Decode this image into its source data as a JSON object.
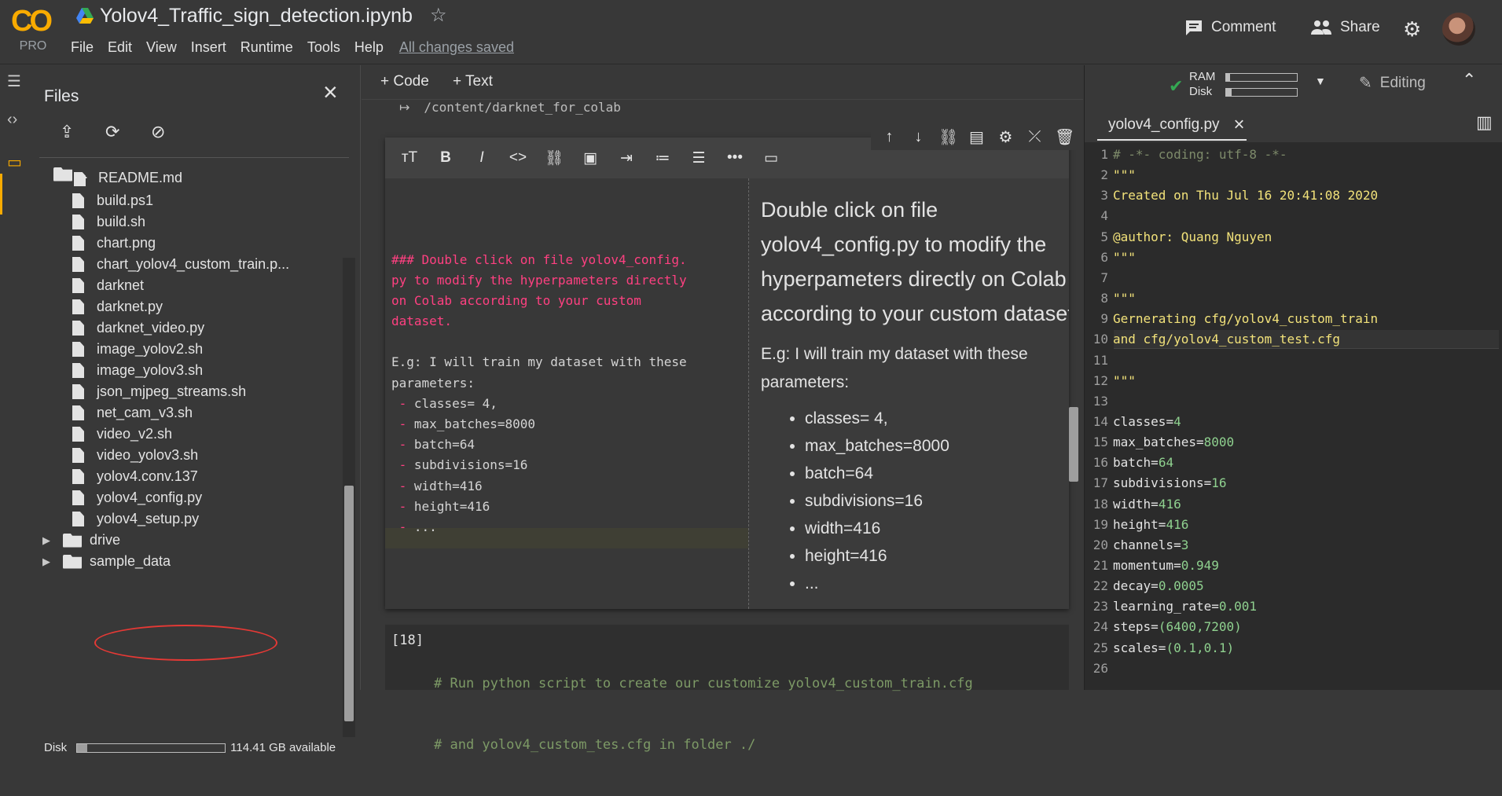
{
  "header": {
    "logo_text": "CO",
    "logo_badge": "PRO",
    "notebook_title": "Yolov4_Traffic_sign_detection.ipynb",
    "menu": [
      "File",
      "Edit",
      "View",
      "Insert",
      "Runtime",
      "Tools",
      "Help"
    ],
    "save_status": "All changes saved",
    "comment_label": "Comment",
    "share_label": "Share"
  },
  "files_panel": {
    "title": "Files",
    "parent_dir": "..",
    "partial_top_item": "README.md",
    "items": [
      {
        "name": "build.ps1",
        "type": "file"
      },
      {
        "name": "build.sh",
        "type": "file"
      },
      {
        "name": "chart.png",
        "type": "file"
      },
      {
        "name": "chart_yolov4_custom_train.p...",
        "type": "file"
      },
      {
        "name": "darknet",
        "type": "file"
      },
      {
        "name": "darknet.py",
        "type": "file"
      },
      {
        "name": "darknet_video.py",
        "type": "file"
      },
      {
        "name": "image_yolov2.sh",
        "type": "file"
      },
      {
        "name": "image_yolov3.sh",
        "type": "file"
      },
      {
        "name": "json_mjpeg_streams.sh",
        "type": "file"
      },
      {
        "name": "net_cam_v3.sh",
        "type": "file"
      },
      {
        "name": "video_v2.sh",
        "type": "file"
      },
      {
        "name": "video_yolov3.sh",
        "type": "file"
      },
      {
        "name": "yolov4.conv.137",
        "type": "file"
      },
      {
        "name": "yolov4_config.py",
        "type": "file",
        "highlighted": true
      },
      {
        "name": "yolov4_setup.py",
        "type": "file"
      },
      {
        "name": "drive",
        "type": "folder"
      },
      {
        "name": "sample_data",
        "type": "folder"
      }
    ],
    "disk_label": "Disk",
    "disk_available": "114.41 GB available",
    "disk_used_fraction": 0.07,
    "highlight_color": "#e53935"
  },
  "notebook": {
    "add_code": "+ Code",
    "add_text": "+ Text",
    "output_path": "/content/darknet_for_colab",
    "markdown_source": {
      "heading_lines": [
        "### Double click on file yolov4_config.",
        "py to modify the hyperpameters directly",
        "on Colab according to your custom",
        "dataset."
      ],
      "body_lines": [
        "E.g: I will train my dataset with these",
        "parameters:"
      ],
      "bullets": [
        " - classes= 4,",
        " - max_batches=8000",
        " - batch=64",
        " - subdivisions=16",
        " - width=416",
        " - height=416",
        " - ..."
      ]
    },
    "markdown_preview": {
      "heading": "Double click on file yolov4_config.py to modify the hyperpameters directly on Colab according to your custom dataset.",
      "paragraph": "E.g: I will train my dataset with these parameters:",
      "bullets": [
        "classes= 4,",
        "max_batches=8000",
        "batch=64",
        "subdivisions=16",
        "width=416",
        "height=416",
        "..."
      ]
    },
    "code_cell": {
      "exec_count": "[18]",
      "lines": [
        "# Run python script to create our customize yolov4_custom_train.cfg",
        "# and yolov4_custom_tes.cfg in folder ./"
      ]
    }
  },
  "runtime": {
    "ram_label": "RAM",
    "disk_label": "Disk",
    "ram_fraction": 0.05,
    "disk_fraction": 0.08,
    "editing_label": "Editing"
  },
  "editor": {
    "tab_name": "yolov4_config.py",
    "lines": [
      {
        "n": "1",
        "text": "# -*- coding: utf-8 -*-",
        "kind": "comment"
      },
      {
        "n": "2",
        "text": "\"\"\"",
        "kind": "string"
      },
      {
        "n": "3",
        "text": "Created on Thu Jul 16 20:41:08 2020",
        "kind": "string"
      },
      {
        "n": "4",
        "text": "",
        "kind": "plain"
      },
      {
        "n": "5",
        "text": "@author: Quang Nguyen",
        "kind": "string"
      },
      {
        "n": "6",
        "text": "\"\"\"",
        "kind": "string"
      },
      {
        "n": "7",
        "text": "",
        "kind": "plain"
      },
      {
        "n": "8",
        "text": "\"\"\"",
        "kind": "string"
      },
      {
        "n": "9",
        "text": "Gernerating cfg/yolov4_custom_train",
        "kind": "string"
      },
      {
        "n": "10",
        "text": "and cfg/yolov4_custom_test.cfg",
        "kind": "string"
      },
      {
        "n": "11",
        "text": "",
        "kind": "plain"
      },
      {
        "n": "12",
        "text": "\"\"\"",
        "kind": "string"
      },
      {
        "n": "13",
        "text": "",
        "kind": "plain"
      },
      {
        "n": "14",
        "text": "classes=4",
        "kind": "assign",
        "key": "classes",
        "val": "4"
      },
      {
        "n": "15",
        "text": "max_batches=8000",
        "kind": "assign",
        "key": "max_batches",
        "val": "8000"
      },
      {
        "n": "16",
        "text": "batch=64",
        "kind": "assign",
        "key": "batch",
        "val": "64"
      },
      {
        "n": "17",
        "text": "subdivisions=16",
        "kind": "assign",
        "key": "subdivisions",
        "val": "16"
      },
      {
        "n": "18",
        "text": "width=416",
        "kind": "assign",
        "key": "width",
        "val": "416"
      },
      {
        "n": "19",
        "text": "height=416",
        "kind": "assign",
        "key": "height",
        "val": "416"
      },
      {
        "n": "20",
        "text": "channels=3",
        "kind": "assign",
        "key": "channels",
        "val": "3"
      },
      {
        "n": "21",
        "text": "momentum=0.949",
        "kind": "assign",
        "key": "momentum",
        "val": "0.949"
      },
      {
        "n": "22",
        "text": "decay=0.0005",
        "kind": "assign",
        "key": "decay",
        "val": "0.0005"
      },
      {
        "n": "23",
        "text": "learning_rate=0.001",
        "kind": "assign",
        "key": "learning_rate",
        "val": "0.001"
      },
      {
        "n": "24",
        "text": "steps= (6400,7200)",
        "kind": "assign",
        "key": "steps",
        "val": "(6400,7200)"
      },
      {
        "n": "25",
        "text": "scales=(0.1,0.1)",
        "kind": "assign",
        "key": "scales",
        "val": "(0.1,0.1)"
      },
      {
        "n": "26",
        "text": "",
        "kind": "plain"
      }
    ]
  },
  "colors": {
    "brand_orange": "#f9ab00",
    "string_yellow": "#f2e27a",
    "comment_grey": "#7d8a6a",
    "number_green": "#8fd18f",
    "md_pink": "#ff4081",
    "check_green": "#34a853"
  }
}
